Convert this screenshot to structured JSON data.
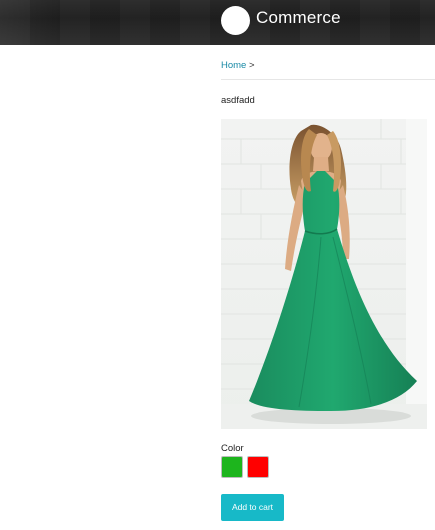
{
  "header": {
    "brand": "Commerce",
    "logo_icon": "circle-logo-icon"
  },
  "breadcrumb": {
    "home": "Home",
    "separator": ">"
  },
  "product": {
    "title": "asdfadd",
    "image_icon": "green-maxi-dress-photo",
    "color_label": "Color",
    "colors": [
      "#1db51d",
      "#ff0000"
    ],
    "add_to_cart": "Add to cart"
  }
}
